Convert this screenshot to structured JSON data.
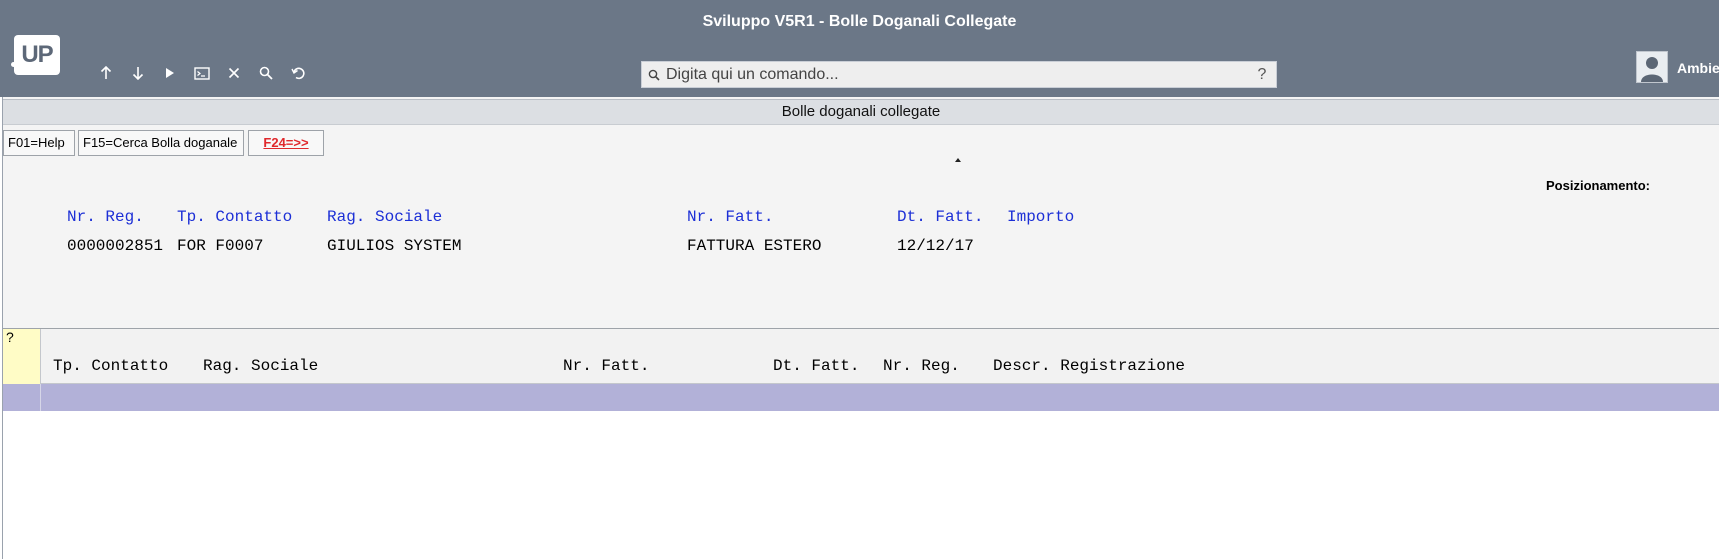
{
  "app": {
    "title": "Sviluppo V5R1 - Bolle Doganali Collegate",
    "logo": "UP",
    "user_label": "Ambie"
  },
  "toolbar": {
    "icons": [
      "arrow-up-icon",
      "arrow-down-icon",
      "play-icon",
      "terminal-icon",
      "close-icon",
      "search-icon",
      "undo-icon"
    ]
  },
  "command": {
    "placeholder": "Digita qui un comando...",
    "help": "?"
  },
  "window": {
    "title": "Bolle doganali collegate"
  },
  "function_keys": {
    "f01": "F01=Help",
    "f15": "F15=Cerca Bolla doganale",
    "f24": "F24=>>"
  },
  "positioning_label": "Posizionamento:",
  "record": {
    "headers": {
      "nr_reg": "Nr. Reg.",
      "tp_contatto": "Tp. Contatto",
      "rag_sociale": "Rag. Sociale",
      "nr_fatt": "Nr. Fatt.",
      "dt_fatt": "Dt. Fatt.",
      "importo": "Importo"
    },
    "values": {
      "nr_reg": "0000002851",
      "tp_contatto": "FOR F0007",
      "rag_sociale": "GIULIOS SYSTEM",
      "nr_fatt": "FATTURA ESTERO",
      "dt_fatt": "12/12/17"
    }
  },
  "grid": {
    "select_header": "?",
    "columns": {
      "tp_contatto": "Tp. Contatto",
      "rag_sociale": "Rag. Sociale",
      "nr_fatt": "Nr. Fatt.",
      "dt_fatt": "Dt. Fatt.",
      "nr_reg": "Nr. Reg.",
      "descr": "Descr. Registrazione"
    }
  },
  "colors": {
    "topbar": "#6b7787",
    "header_text": "#1c2fd6",
    "selected_row": "#b2b1d8",
    "select_column": "#fffcc6",
    "f24": "#e0282c"
  }
}
